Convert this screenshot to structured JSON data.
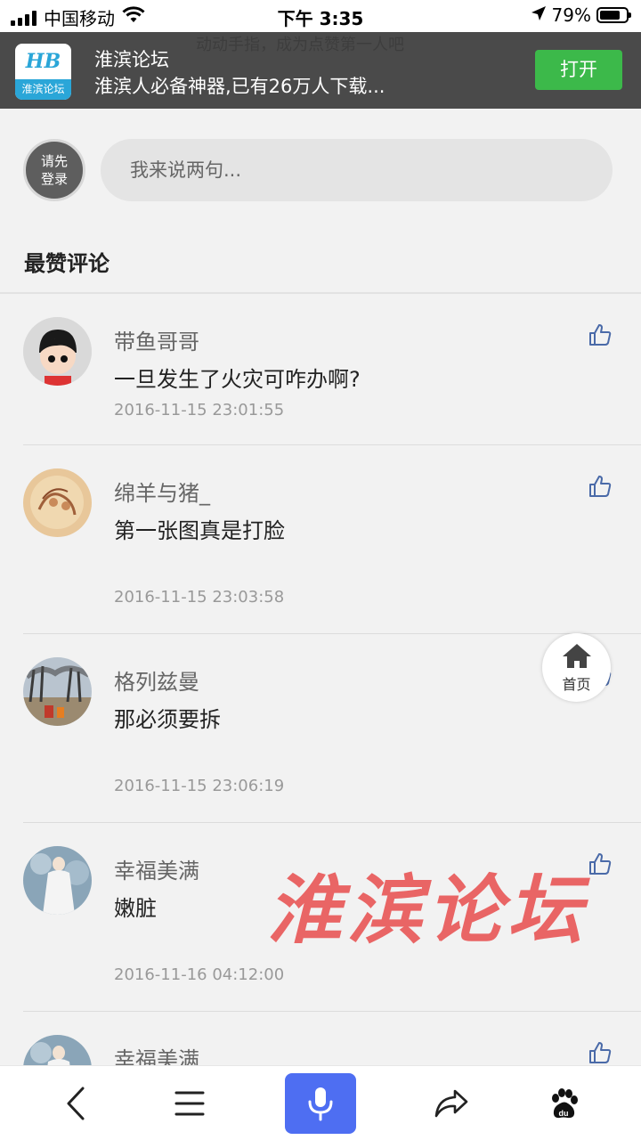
{
  "status_bar": {
    "carrier": "中国移动",
    "time": "下午 3:35",
    "battery": "79%",
    "battery_level": 0.79,
    "icons": [
      "signal-icon",
      "wifi-icon",
      "location-icon",
      "battery-icon"
    ]
  },
  "app_banner": {
    "behind_text": "动动手指，成为点赞第一人吧",
    "logo_text": "淮滨论坛",
    "logo_mark": "HB",
    "title": "淮滨论坛",
    "subtitle": "淮滨人必备神器,已有26万人下载...",
    "open_label": "打开"
  },
  "comment_box": {
    "login_label": "请先登录",
    "placeholder": "我来说两句..."
  },
  "section_title": "最赞评论",
  "comments": [
    {
      "name": "带鱼哥哥",
      "text": "一旦发生了火灾可咋办啊?",
      "time": "2016-11-15 23:01:55"
    },
    {
      "name": "绵羊与猪_",
      "text": "第一张图真是打脸",
      "time": "2016-11-15 23:03:58"
    },
    {
      "name": "格列兹曼",
      "text": "那必须要拆",
      "time": "2016-11-15 23:06:19"
    },
    {
      "name": "幸福美满",
      "text": "嫩脏",
      "time": "2016-11-16 04:12:00"
    },
    {
      "name": "幸福美满",
      "text": "",
      "time": ""
    }
  ],
  "home_float": {
    "label": "首页"
  },
  "watermark": "淮滨论坛",
  "bottom_bar": {
    "items": [
      "back-icon",
      "menu-icon",
      "mic-icon",
      "share-icon",
      "baidu-paw-icon"
    ]
  },
  "colors": {
    "banner_bg": "#4a4a4a",
    "open_button": "#3cb94a",
    "mic_button": "#4e6ef2",
    "watermark": "#e64646",
    "like_icon": "#4a6aa8"
  }
}
